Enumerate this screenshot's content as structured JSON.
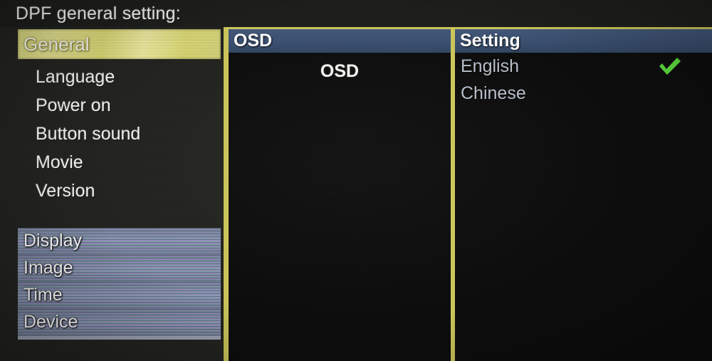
{
  "title": "DPF general setting:",
  "colors": {
    "screen_bg": "#1e1e1c",
    "panel_bg": "#0d0d0d",
    "panel_border": "#cfc85c",
    "header_bar": "#3b5071",
    "highlight_yellow": "#d8d77a",
    "check_green": "#5ee040",
    "option_text": "#b9c1cd"
  },
  "left_panel": {
    "selected": {
      "label": "General",
      "highlighted": true
    },
    "items": [
      {
        "label": "Language"
      },
      {
        "label": "Power on"
      },
      {
        "label": "Button sound"
      },
      {
        "label": "Movie"
      },
      {
        "label": "Version"
      }
    ],
    "bottom_group": [
      {
        "label": "Display"
      },
      {
        "label": "Image"
      },
      {
        "label": "Time"
      },
      {
        "label": "Device"
      }
    ]
  },
  "mid_panel": {
    "header": "OSD",
    "items": [
      {
        "label": "OSD"
      }
    ]
  },
  "right_panel": {
    "header": "Setting",
    "options": [
      {
        "label": "English",
        "checked": true,
        "check_icon": "check-icon"
      },
      {
        "label": "Chinese",
        "checked": false,
        "check_icon": ""
      }
    ]
  }
}
